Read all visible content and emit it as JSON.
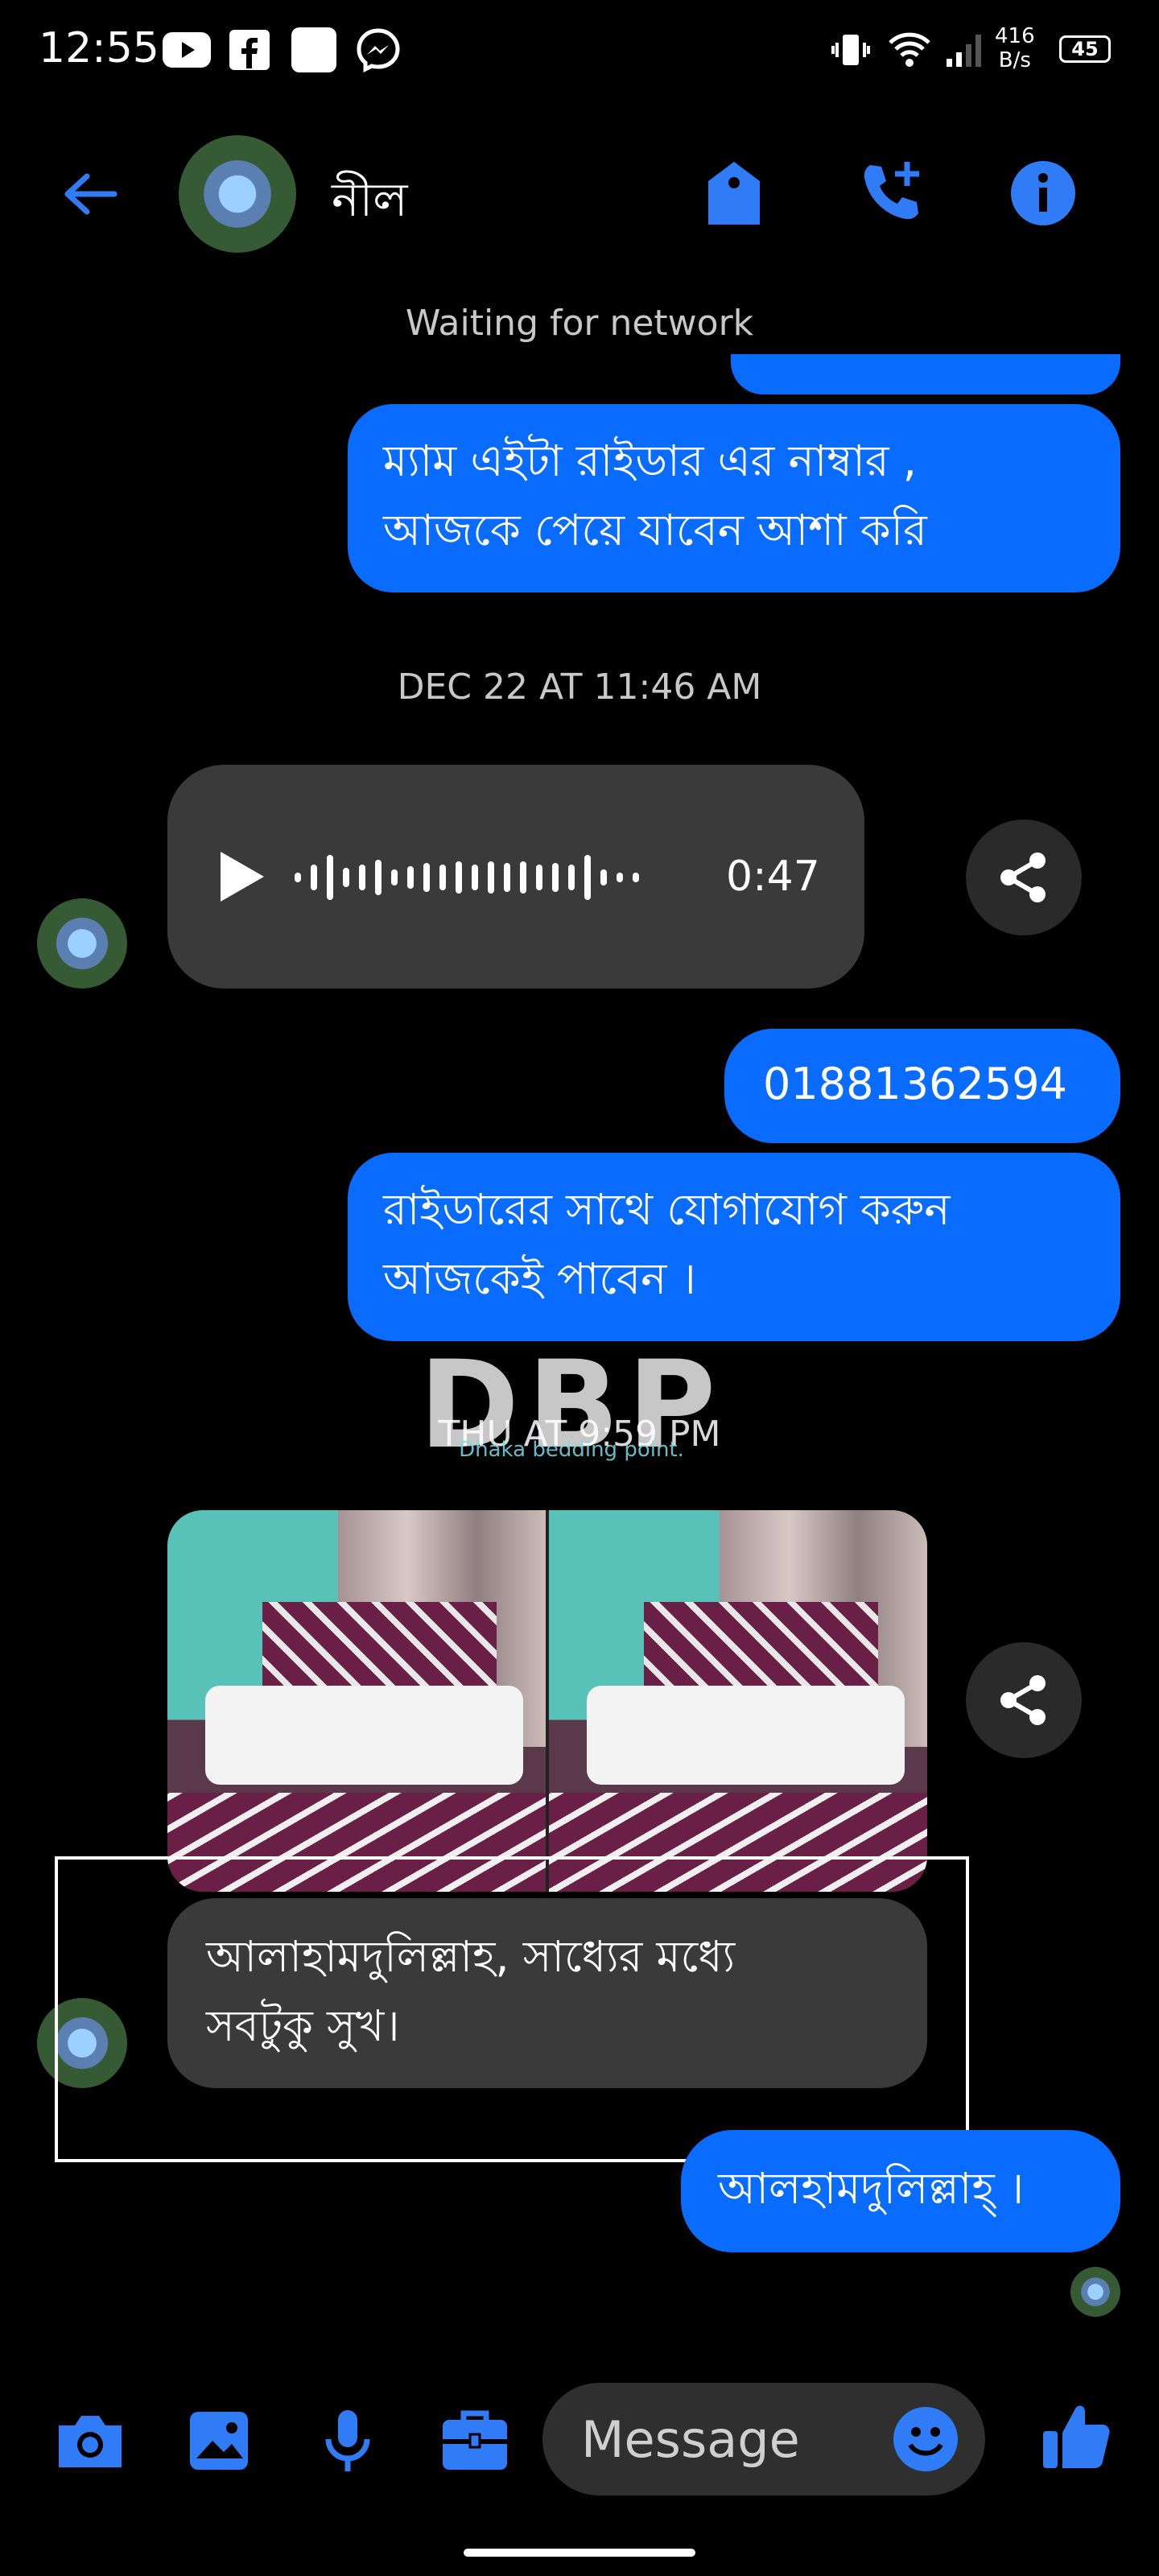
{
  "status_bar": {
    "time": "12:55",
    "net_speed_value": "416",
    "net_speed_unit": "B/s",
    "battery": "45"
  },
  "header": {
    "contact_name": "নীল"
  },
  "network_status": "Waiting for network",
  "messages": {
    "rider_note": "ম্যাম এইটা রাইডার এর নাম্বার ,\nআজকে পেয়ে যাবেন আশা করি",
    "timestamp_1": "DEC 22 AT 11:46 AM",
    "voice_duration": "0:47",
    "phone_number": "01881362594",
    "contact_rider": "রাইডারের সাথে যোগাযোগ করুন\nআজকেই পাবেন ।",
    "timestamp_2": "THU AT 9:59 PM",
    "watermark_logo": "DBP",
    "watermark_subtitle": "Dhaka bedding point.",
    "incoming_reply": "আলাহামদুলিল্লাহ, সাধ্যের মধ্যে\nসবটুকু সুখ।",
    "outgoing_reply": "আলহামদুলিল্লাহ্ ।"
  },
  "composer": {
    "placeholder": "Message"
  },
  "colors": {
    "accent": "#0a6cff",
    "icon_blue": "#2f7cf6",
    "incoming_bubble": "#3a3a3a",
    "background": "#000000"
  }
}
